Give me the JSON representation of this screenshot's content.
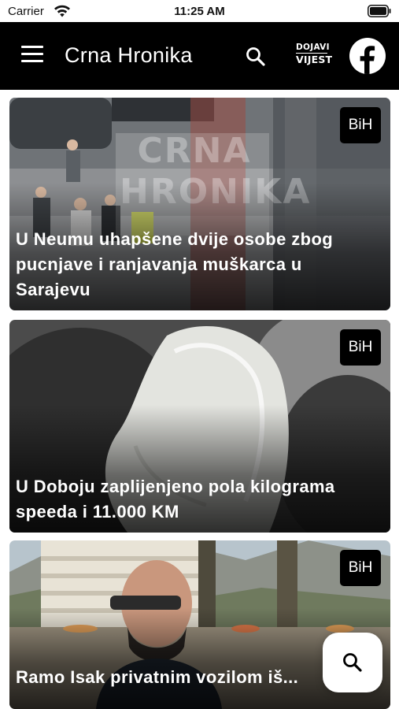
{
  "status_bar": {
    "carrier": "Carrier",
    "time": "11:25 AM"
  },
  "header": {
    "title": "Crna Hronika",
    "menu_icon": "hamburger-menu-icon",
    "search_icon": "search-icon",
    "dojavi_logo": {
      "line1": "DOJAVI",
      "line2": "VIJEST"
    },
    "facebook_icon": "facebook-icon"
  },
  "articles": [
    {
      "badge": "BiH",
      "title": "U Neumu uhapšene dvije osobe zbog pucnjave i ranjavanja muškarca u Sarajevu",
      "watermark": "CRNA HRONIKA"
    },
    {
      "badge": "BiH",
      "title": "U Doboju zaplijenjeno pola kilograma speeda i 11.000 KM"
    },
    {
      "badge": "BiH",
      "title": "Ramo Isak privatnim vozilom iš..."
    }
  ],
  "fab": {
    "icon": "search-icon"
  },
  "colors": {
    "nav_bg": "#000000",
    "badge_bg": "#000000",
    "text_light": "#ffffff"
  }
}
